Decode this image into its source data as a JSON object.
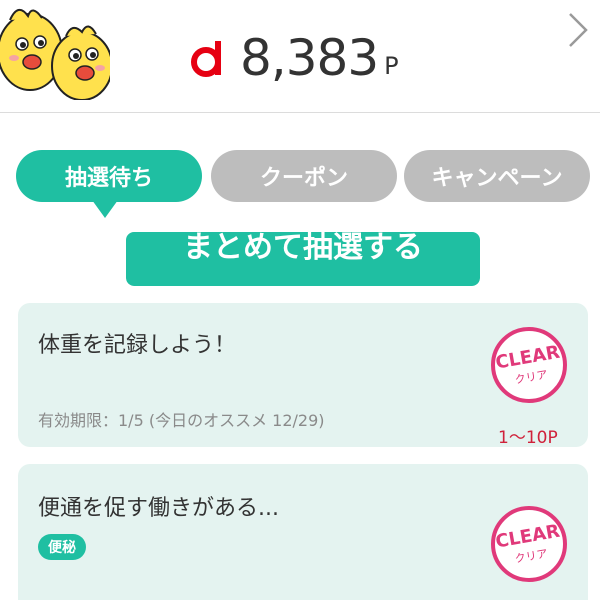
{
  "header": {
    "points_value": "8,383",
    "points_unit": "P",
    "brand_color": "#e60012"
  },
  "tabs": [
    {
      "label": "抽選待ち",
      "active": true
    },
    {
      "label": "クーポン",
      "active": false
    },
    {
      "label": "キャンペーン",
      "active": false
    }
  ],
  "lottery_button": {
    "label": "まとめて抽選する"
  },
  "cards": [
    {
      "title": "体重を記録しよう！",
      "meta": "有効期限：1/5 (今日のオススメ 12/29)",
      "reward": "1〜10P",
      "badge": {
        "top": "CLEAR",
        "bottom": "クリア"
      }
    },
    {
      "title": "便通を促す働きがある...",
      "tag": "便秘",
      "badge": {
        "top": "CLEAR",
        "bottom": "クリア"
      }
    }
  ],
  "colors": {
    "accent": "#1fbfa2",
    "card_bg": "#e4f3f0",
    "badge": "#e0397a",
    "inactive_tab": "#bdbdbd"
  }
}
